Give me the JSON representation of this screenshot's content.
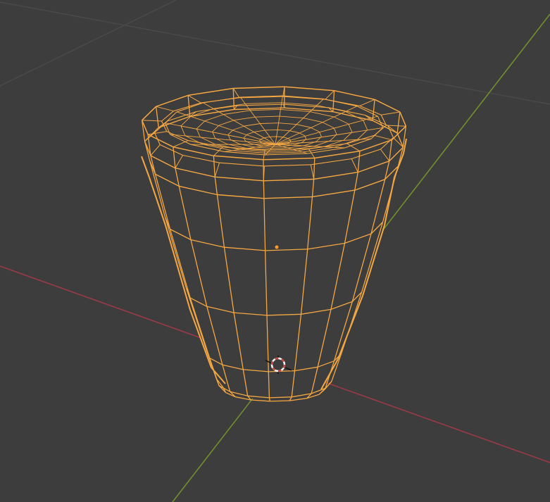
{
  "viewport": {
    "background_color": "#3d3d3d",
    "grid_line_color": "#4a4a4a",
    "x_axis_color": "#9b3a47",
    "y_axis_color": "#6f8f2c",
    "selection_color": "#f5a742",
    "object_origin_color": "#ff9c2a",
    "cursor_colors": [
      "#c8463b",
      "#ffffff"
    ],
    "object": {
      "shape": "cup / cone mesh in edit mode wireframe",
      "selected": true,
      "display_mode": "wireframe"
    },
    "icons": {
      "cursor": "3d-cursor-icon",
      "origin": "object-origin-icon"
    }
  }
}
